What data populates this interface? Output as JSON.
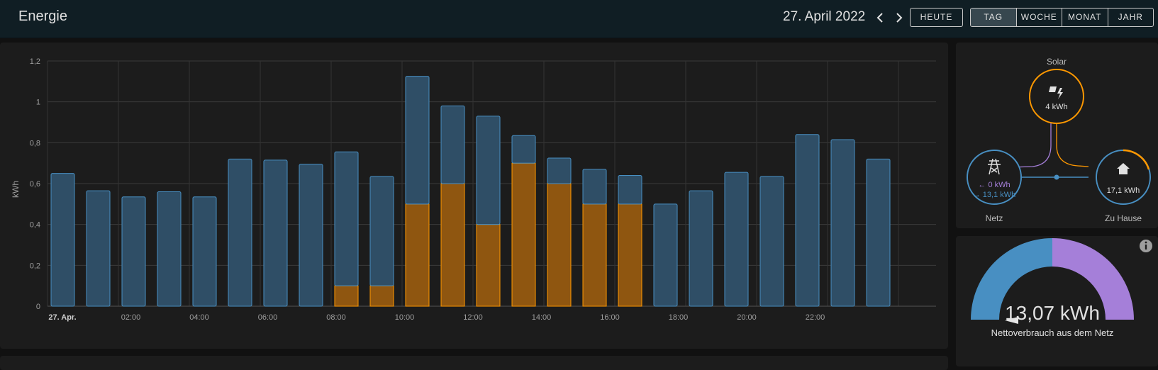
{
  "header": {
    "title": "Energie",
    "date": "27. April 2022",
    "today_label": "HEUTE",
    "periods": [
      "TAG",
      "WOCHE",
      "MONAT",
      "JAHR"
    ],
    "active_period": "TAG"
  },
  "chart_data": {
    "type": "bar",
    "stacked": true,
    "ylabel": "kWh",
    "ylim": [
      0,
      1.2
    ],
    "y_ticks": [
      "1,2",
      "1",
      "0,8",
      "0,6",
      "0,4",
      "0,2",
      "0"
    ],
    "x_ticks": [
      "27. Apr.",
      "02:00",
      "04:00",
      "06:00",
      "08:00",
      "10:00",
      "12:00",
      "14:00",
      "16:00",
      "18:00",
      "20:00",
      "22:00"
    ],
    "categories": [
      "00:00",
      "01:00",
      "02:00",
      "03:00",
      "04:00",
      "05:00",
      "06:00",
      "07:00",
      "08:00",
      "09:00",
      "10:00",
      "11:00",
      "12:00",
      "13:00",
      "14:00",
      "15:00",
      "16:00",
      "17:00",
      "18:00",
      "19:00",
      "20:00",
      "21:00",
      "22:00",
      "23:00"
    ],
    "series": [
      {
        "color": "#ff9800",
        "values": [
          0,
          0,
          0,
          0,
          0,
          0,
          0,
          0,
          0.1,
          0.1,
          0.5,
          0.6,
          0.4,
          0.7,
          0.6,
          0.5,
          0.5,
          0,
          0,
          0,
          0,
          0,
          0,
          0
        ]
      },
      {
        "color": "#488fc2",
        "values": [
          0.65,
          0.565,
          0.535,
          0.56,
          0.535,
          0.72,
          0.715,
          0.695,
          0.655,
          0.535,
          0.625,
          0.38,
          0.53,
          0.135,
          0.125,
          0.17,
          0.14,
          0.5,
          0.565,
          0.655,
          0.635,
          0.84,
          0.815,
          0.72
        ]
      }
    ]
  },
  "energy_flow": {
    "solar": {
      "label": "Solar",
      "value": "4 kWh",
      "icon": "solar-power-icon",
      "color": "#ff9800"
    },
    "grid": {
      "label": "Netz",
      "from": "0 kWh",
      "to": "13,1 kWh",
      "icon": "transmission-tower-icon",
      "color": "#488fc2"
    },
    "home": {
      "label": "Zu Hause",
      "value": "17,1 kWh",
      "icon": "home-icon",
      "color": "#488fc2"
    }
  },
  "gauge": {
    "value": "13,07 kWh",
    "label": "Nettoverbrauch aus dem Netz",
    "info_icon": "info-icon",
    "colors": {
      "left": "#488fc2",
      "right": "#a57fd9",
      "needle": "#e6e6e6"
    }
  }
}
